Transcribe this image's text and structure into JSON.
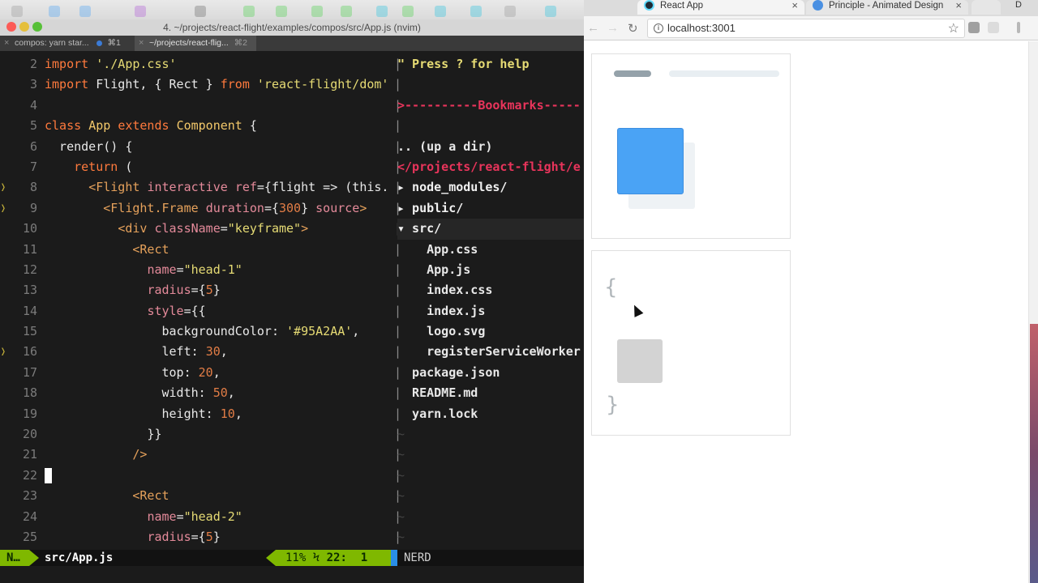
{
  "terminal": {
    "window_title": "4. ~/projects/react-flight/examples/compos/src/App.js (nvim)",
    "tabs": [
      {
        "label": "compos: yarn star...",
        "shortcut": "⌘1",
        "active": false
      },
      {
        "label": "~/projects/react-flig...",
        "shortcut": "⌘2",
        "active": true
      }
    ],
    "code_lines": [
      {
        "num": "2",
        "html": "<span class=\"kw\">import</span> <span class=\"str\">'./App.css'</span>"
      },
      {
        "num": "3",
        "html": "<span class=\"kw\">import</span> Flight, { Rect } <span class=\"kw\">from</span> <span class=\"str\">'react-flight/dom'</span>"
      },
      {
        "num": "4",
        "html": ""
      },
      {
        "num": "5",
        "html": "<span class=\"kw\">class</span> <span class=\"cls\">App</span> <span class=\"kw\">extends</span> <span class=\"cls\">Component</span> {"
      },
      {
        "num": "6",
        "html": "  render() {"
      },
      {
        "num": "7",
        "html": "    <span class=\"kw\">return</span> ("
      },
      {
        "num": "8",
        "mark": "❭",
        "html": "      <span class=\"tag\">&lt;Flight</span> <span class=\"attr\">interactive</span> <span class=\"attr\">ref</span>={flight =&gt; (this."
      },
      {
        "num": "9",
        "mark": "❭",
        "html": "        <span class=\"tag\">&lt;Flight.Frame</span> <span class=\"attr\">duration</span>={<span class=\"num\">300</span>} <span class=\"attr\">source</span><span class=\"tag\">&gt;</span>"
      },
      {
        "num": "10",
        "html": "          <span class=\"tag\">&lt;div</span> <span class=\"attr\">className</span>=<span class=\"str\">\"keyframe\"</span><span class=\"tag\">&gt;</span>"
      },
      {
        "num": "11",
        "html": "            <span class=\"tag\">&lt;Rect</span>"
      },
      {
        "num": "12",
        "html": "              <span class=\"attr\">name</span>=<span class=\"str\">\"head-1\"</span>"
      },
      {
        "num": "13",
        "html": "              <span class=\"attr\">radius</span>={<span class=\"num\">5</span>}"
      },
      {
        "num": "14",
        "html": "              <span class=\"attr\">style</span>={{"
      },
      {
        "num": "15",
        "html": "                backgroundColor: <span class=\"str\">'#95A2AA'</span>,"
      },
      {
        "num": "16",
        "mark": "❭",
        "html": "                left: <span class=\"num\">30</span>,"
      },
      {
        "num": "17",
        "html": "                top: <span class=\"num\">20</span>,"
      },
      {
        "num": "18",
        "html": "                width: <span class=\"num\">50</span>,"
      },
      {
        "num": "19",
        "html": "                height: <span class=\"num\">10</span>,"
      },
      {
        "num": "20",
        "html": "              }}"
      },
      {
        "num": "21",
        "html": "            <span class=\"tag\">/&gt;</span>"
      },
      {
        "num": "22",
        "cursor": true,
        "html": ""
      },
      {
        "num": "23",
        "html": "            <span class=\"tag\">&lt;Rect</span>"
      },
      {
        "num": "24",
        "html": "              <span class=\"attr\">name</span>=<span class=\"str\">\"head-2\"</span>"
      },
      {
        "num": "25",
        "html": "              <span class=\"attr\">radius</span>={<span class=\"num\">5</span>}"
      }
    ],
    "tree_lines": [
      {
        "text": "\" Press ? for help",
        "cls": "help"
      },
      {
        "text": "",
        "cls": ""
      },
      {
        "text": ">----------Bookmarks-----",
        "cls": "bm"
      },
      {
        "text": "",
        "cls": ""
      },
      {
        "text": ".. (up a dir)",
        "cls": ""
      },
      {
        "text": "</projects/react-flight/e",
        "cls": "path"
      },
      {
        "text": "▸ node_modules/",
        "cls": "dir"
      },
      {
        "text": "▸ public/",
        "cls": "dir"
      },
      {
        "text": "▾ src/",
        "cls": "dir hl"
      },
      {
        "text": "    App.css",
        "cls": ""
      },
      {
        "text": "    App.js",
        "cls": ""
      },
      {
        "text": "    index.css",
        "cls": ""
      },
      {
        "text": "    index.js",
        "cls": ""
      },
      {
        "text": "    logo.svg",
        "cls": ""
      },
      {
        "text": "    registerServiceWorker",
        "cls": ""
      },
      {
        "text": "  package.json",
        "cls": ""
      },
      {
        "text": "  README.md",
        "cls": ""
      },
      {
        "text": "  yarn.lock",
        "cls": ""
      },
      {
        "text": "~",
        "cls": "tilde"
      },
      {
        "text": "~",
        "cls": "tilde"
      },
      {
        "text": "~",
        "cls": "tilde"
      },
      {
        "text": "~",
        "cls": "tilde"
      },
      {
        "text": "~",
        "cls": "tilde"
      },
      {
        "text": "~",
        "cls": "tilde"
      },
      {
        "text": "~",
        "cls": "tilde"
      }
    ],
    "status": {
      "mode": "N…",
      "file": "src/App.js",
      "percent": "11%",
      "line_icon": "Ϟ",
      "line": "22:",
      "col": "1",
      "nerd": "NERD"
    }
  },
  "browser": {
    "tabs": [
      {
        "title": "React App",
        "close": "×"
      },
      {
        "title": "Principle - Animated Design",
        "close": "×"
      }
    ],
    "profile_letter": "D",
    "back": "←",
    "forward": "→",
    "reload": "↻",
    "url": "localhost:3001",
    "star": "☆",
    "page": {
      "brace_open": "{",
      "brace_close": "}"
    },
    "colors": {
      "head_bar": "#95A2AA",
      "blue_rect": "#4AA3F5",
      "gray_rect": "#D3D3D3"
    }
  }
}
